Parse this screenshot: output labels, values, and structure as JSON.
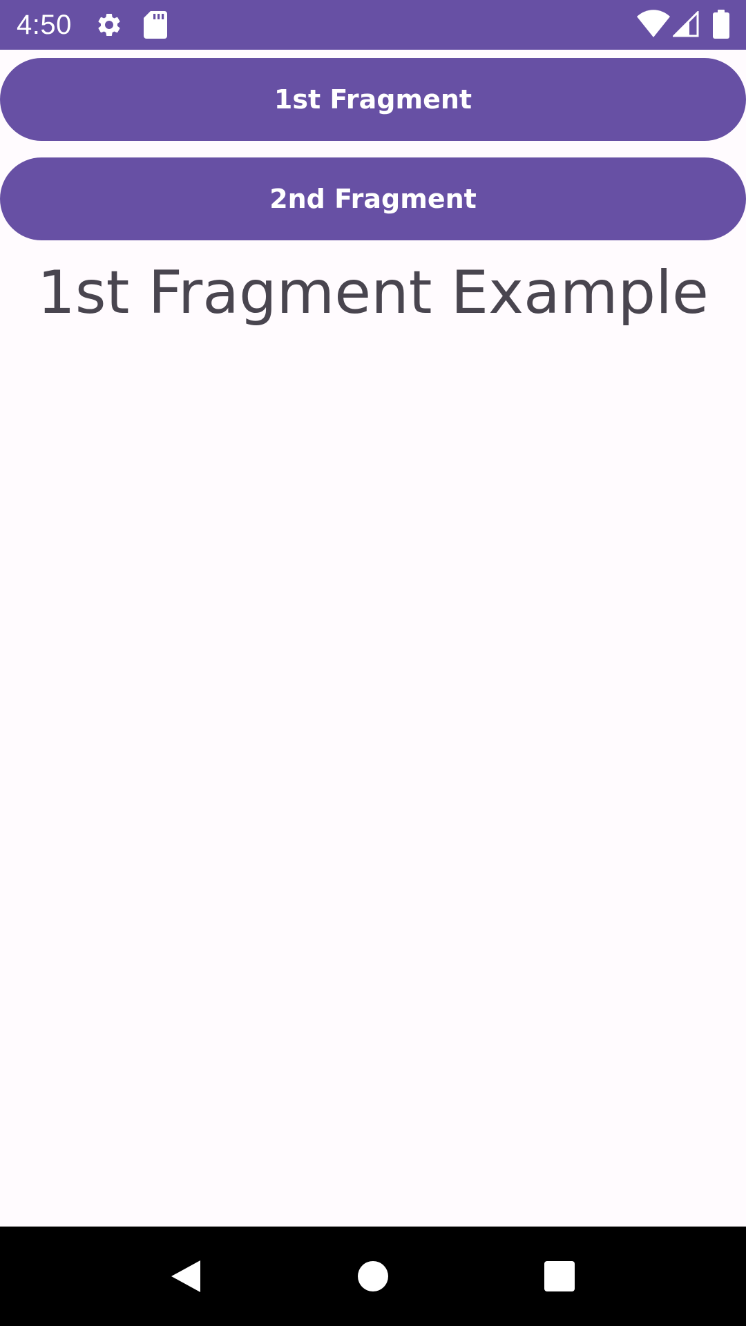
{
  "status_bar": {
    "time": "4:50",
    "background": "#6750A4",
    "left_icons": [
      "gear-icon",
      "sd-card-icon"
    ],
    "right_icons": [
      "wifi-icon",
      "cellular-signal-icon",
      "battery-icon"
    ]
  },
  "buttons": {
    "first_label": "1st Fragment",
    "second_label": "2nd Fragment",
    "color": "#6750A4"
  },
  "fragment": {
    "title": "1st Fragment Example",
    "background": "#FFFBFE"
  },
  "nav_bar": {
    "keys": [
      "back-icon",
      "home-icon",
      "recents-icon"
    ]
  }
}
